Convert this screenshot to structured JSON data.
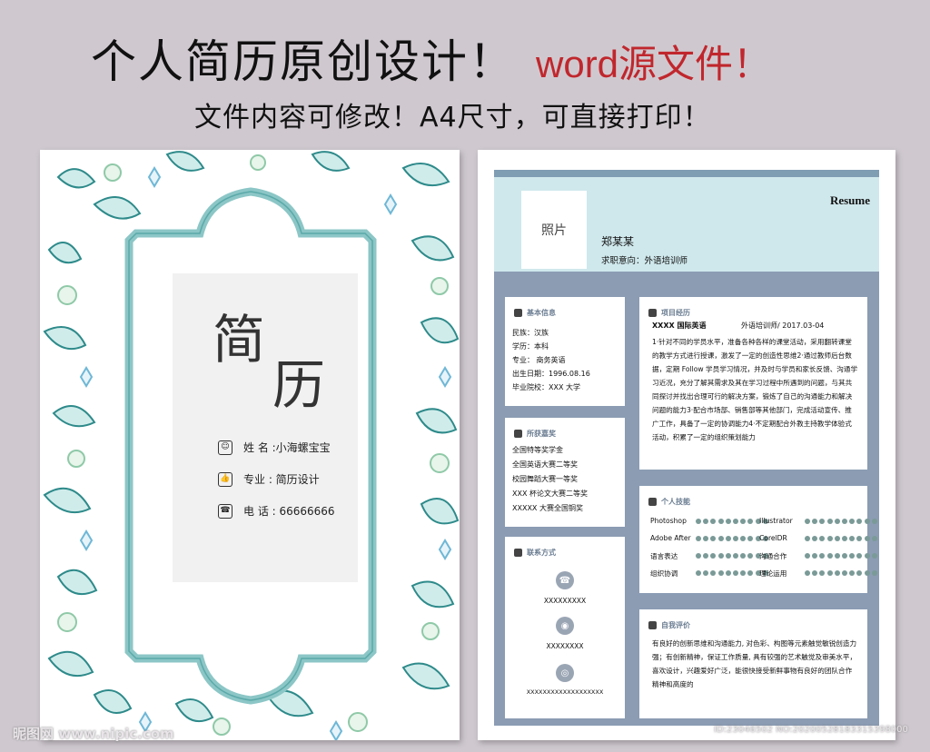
{
  "header": {
    "headline": "个人简历原创设计！",
    "headline_accent": "word源文件！",
    "subline": "文件内容可修改！A4尺寸，可直接打印！"
  },
  "cover": {
    "title_char_1": "简",
    "title_char_2": "历",
    "rows": [
      {
        "icon": "id-card-icon",
        "text": "姓   名 :小海螺宝宝"
      },
      {
        "icon": "thumbs-up-icon",
        "text": "专业 : 简历设计"
      },
      {
        "icon": "phone-icon",
        "text": "电   话 : 66666666"
      }
    ]
  },
  "resume": {
    "resume_label": "Resume",
    "photo_label": "照片",
    "name": "郑某某",
    "intent": "求职意向：外语培训师",
    "basic": {
      "title": "基本信息",
      "lines": [
        "民族：汉族",
        "学历：本科",
        "专业：   商务英语",
        "出生日期：1996.08.16",
        "毕业院校：XXX 大学"
      ]
    },
    "awards": {
      "title": "所获嘉奖",
      "lines": [
        "全国特等奖学金",
        "全国英语大赛二等奖",
        "校园舞蹈大赛一等奖",
        "XXX 杯论文大赛二等奖",
        "XXXXX 大赛全国铜奖"
      ]
    },
    "contact": {
      "title": "联系方式",
      "items": [
        "XXXXXXXXX",
        "XXXXXXXX",
        "XXXXXXXXXXXXXXXXXXX"
      ]
    },
    "projects": {
      "title": "项目经历",
      "company": "XXXX 国际英语",
      "role_date": "外语培训师/ 2017.03-04",
      "text": "1·针对不同的学员水平，准备各种各样的课堂活动，采用翻转课堂的教学方式进行授课，激发了一定的创造性思维2·通过教师后台数据，定期 Follow 学员学习情况，并及时与学员和家长反馈、沟通学习近况，充分了解其需求及其在学习过程中所遇到的问题，与其共同探讨并找出合理可行的解决方案，锻炼了自己的沟通能力和解决问题的能力3·配合市场部、销售部等其他部门，完成活动宣传、推广工作，具备了一定的协调能力4·不定期配合外教主持教学体验式活动，积累了一定的组织策划能力"
    },
    "skills": {
      "title": "个人技能",
      "items": [
        {
          "name": "Photoshop",
          "level": 1.0
        },
        {
          "name": "Illustrator",
          "level": 1.0
        },
        {
          "name": "Adobe After",
          "level": 1.0
        },
        {
          "name": "CorelDR",
          "level": 1.0
        },
        {
          "name": "语言表达",
          "level": 1.0
        },
        {
          "name": "沟通合作",
          "level": 1.0
        },
        {
          "name": "组织协调",
          "level": 1.0
        },
        {
          "name": "理论运用",
          "level": 1.0
        }
      ]
    },
    "self_eval": {
      "title": "自我评价",
      "text": "有良好的创新思维和沟通能力, 对色彩、构图等元素触觉敏锐创造力强；有创新精神，保证工作质量, 具有较强的艺术触觉及审美水平，喜欢设计，兴趣爱好广泛，能很快接受新鲜事物有良好的团队合作精神和高度的"
    }
  },
  "watermark": {
    "left": "昵图网 www.nipic.com",
    "right": "ID:23046502 NO:20200528183315398000"
  },
  "colors": {
    "background": "#cfc9cf",
    "accent_red": "#c0272d",
    "teal": "#2e8a8a",
    "header_band": "#cfe8ec",
    "body_band": "#8b9cb3"
  }
}
